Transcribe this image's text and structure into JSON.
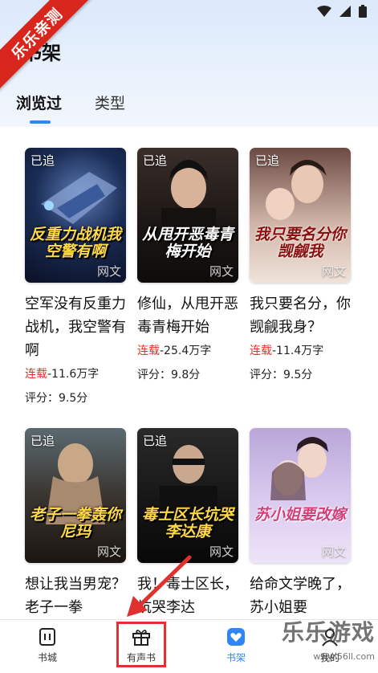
{
  "watermark": {
    "ribbon_text": "乐乐亲测",
    "logo_text": "乐乐游戏",
    "logo_url": "www.56ll.com"
  },
  "header": {
    "title": "书架"
  },
  "tabs": [
    {
      "label": "浏览过"
    },
    {
      "label": "类型"
    }
  ],
  "books": [
    {
      "badge": "已追",
      "cover_text": "反重力战机我空警有啊",
      "cover_source": "网文",
      "title": "空军没有反重力战机，我空警有啊",
      "status": "连载",
      "words": "-11.6万字",
      "rating": "评分：9.5分"
    },
    {
      "badge": "已追",
      "cover_text": "从甩开恶毒青梅开始",
      "cover_source": "网文",
      "title": "修仙，从甩开恶毒青梅开始",
      "status": "连载",
      "words": "-25.4万字",
      "rating": "评分：9.8分"
    },
    {
      "badge": "已追",
      "cover_text": "我只要名分你觊觎我",
      "cover_source": "网文",
      "title": "我只要名分，你觊觎我身？",
      "status": "连载",
      "words": "-11.4万字",
      "rating": "评分：9.5分"
    },
    {
      "badge": "已追",
      "cover_text": "老子一拳轰你尼玛",
      "cover_source": "网文",
      "title": "想让我当男宠？老子一拳"
    },
    {
      "badge": "已追",
      "cover_text": "毒士区长坑哭李达康",
      "cover_source": "网文",
      "title": "我！毒士区长，坑哭李达"
    },
    {
      "badge": "",
      "cover_text": "苏小姐要改嫁",
      "cover_source": "网文",
      "title": "给命文学晚了，苏小姐要"
    }
  ],
  "bottom_nav": [
    {
      "label": "书城",
      "icon": "bookstore-icon"
    },
    {
      "label": "有声书",
      "icon": "gift-icon"
    },
    {
      "label": "书架",
      "icon": "bookshelf-icon",
      "active": true
    },
    {
      "label": "我的",
      "icon": "profile-icon"
    }
  ],
  "colors": {
    "accent": "#2f86f6",
    "status_red": "#e0332c",
    "highlight_red": "#e03030"
  }
}
